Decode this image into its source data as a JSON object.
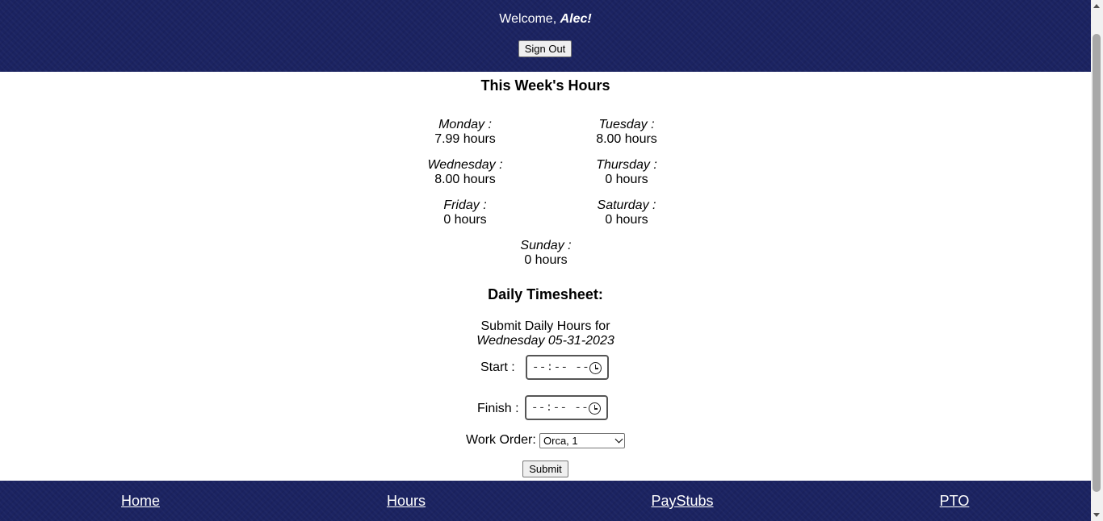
{
  "header": {
    "welcome_prefix": "Welcome, ",
    "user_name": "Alec!",
    "sign_out_label": "Sign Out"
  },
  "hours": {
    "title": "This Week's Hours",
    "days": [
      {
        "name": "Monday :",
        "value": "7.99 hours"
      },
      {
        "name": "Tuesday :",
        "value": "8.00 hours"
      },
      {
        "name": "Wednesday :",
        "value": "8.00 hours"
      },
      {
        "name": "Thursday :",
        "value": "0 hours"
      },
      {
        "name": "Friday :",
        "value": "0 hours"
      },
      {
        "name": "Saturday :",
        "value": "0 hours"
      },
      {
        "name": "Sunday :",
        "value": "0 hours"
      }
    ]
  },
  "timesheet": {
    "title": "Daily Timesheet:",
    "submit_for": "Submit Daily Hours for",
    "date": "Wednesday 05-31-2023",
    "start_label": "Start :",
    "finish_label": "Finish :",
    "time_placeholder": "--:-- --",
    "work_order_label": "Work Order:",
    "work_order_selected": "Orca, 1",
    "submit_label": "Submit"
  },
  "footer": {
    "links": [
      {
        "label": "Home"
      },
      {
        "label": "Hours"
      },
      {
        "label": "PayStubs"
      },
      {
        "label": "PTO"
      }
    ]
  },
  "colors": {
    "band_background": "#1b2361",
    "band_text": "#ffffff"
  }
}
